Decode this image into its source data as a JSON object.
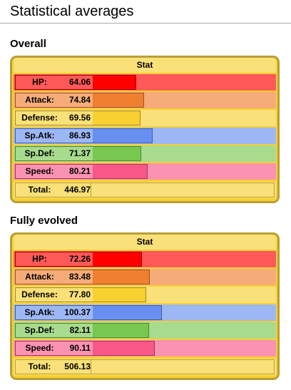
{
  "page_title": "Statistical averages",
  "sections": [
    {
      "title": "Overall",
      "header": "Stat",
      "stats": [
        {
          "label": "HP:",
          "value": "64.06",
          "n": 64.06,
          "bg": "#FF5959",
          "bar": "#FF0000",
          "border": "#A60000"
        },
        {
          "label": "Attack:",
          "value": "74.84",
          "n": 74.84,
          "bg": "#F5AC78",
          "bar": "#F08030",
          "border": "#9C531F"
        },
        {
          "label": "Defense:",
          "value": "69.56",
          "n": 69.56,
          "bg": "#FAE078",
          "bar": "#F8D030",
          "border": "#A1871F"
        },
        {
          "label": "Sp.Atk:",
          "value": "86.93",
          "n": 86.93,
          "bg": "#9DB7F5",
          "bar": "#6890F0",
          "border": "#445E9C"
        },
        {
          "label": "Sp.Def:",
          "value": "71.37",
          "n": 71.37,
          "bg": "#A7DB8D",
          "bar": "#78C850",
          "border": "#4E8234"
        },
        {
          "label": "Speed:",
          "value": "80.21",
          "n": 80.21,
          "bg": "#FA92B2",
          "bar": "#F85888",
          "border": "#A13959"
        }
      ],
      "total_label": "Total:",
      "total": "446.97"
    },
    {
      "title": "Fully evolved",
      "header": "Stat",
      "stats": [
        {
          "label": "HP:",
          "value": "72.26",
          "n": 72.26,
          "bg": "#FF5959",
          "bar": "#FF0000",
          "border": "#A60000"
        },
        {
          "label": "Attack:",
          "value": "83.48",
          "n": 83.48,
          "bg": "#F5AC78",
          "bar": "#F08030",
          "border": "#9C531F"
        },
        {
          "label": "Defense:",
          "value": "77.80",
          "n": 77.8,
          "bg": "#FAE078",
          "bar": "#F8D030",
          "border": "#A1871F"
        },
        {
          "label": "Sp.Atk:",
          "value": "100.37",
          "n": 100.37,
          "bg": "#9DB7F5",
          "bar": "#6890F0",
          "border": "#445E9C"
        },
        {
          "label": "Sp.Def:",
          "value": "82.11",
          "n": 82.11,
          "bg": "#A7DB8D",
          "bar": "#78C850",
          "border": "#4E8234"
        },
        {
          "label": "Speed:",
          "value": "90.11",
          "n": 90.11,
          "bg": "#FA92B2",
          "bar": "#F85888",
          "border": "#A13959"
        }
      ],
      "total_label": "Total:",
      "total": "506.13"
    }
  ]
}
